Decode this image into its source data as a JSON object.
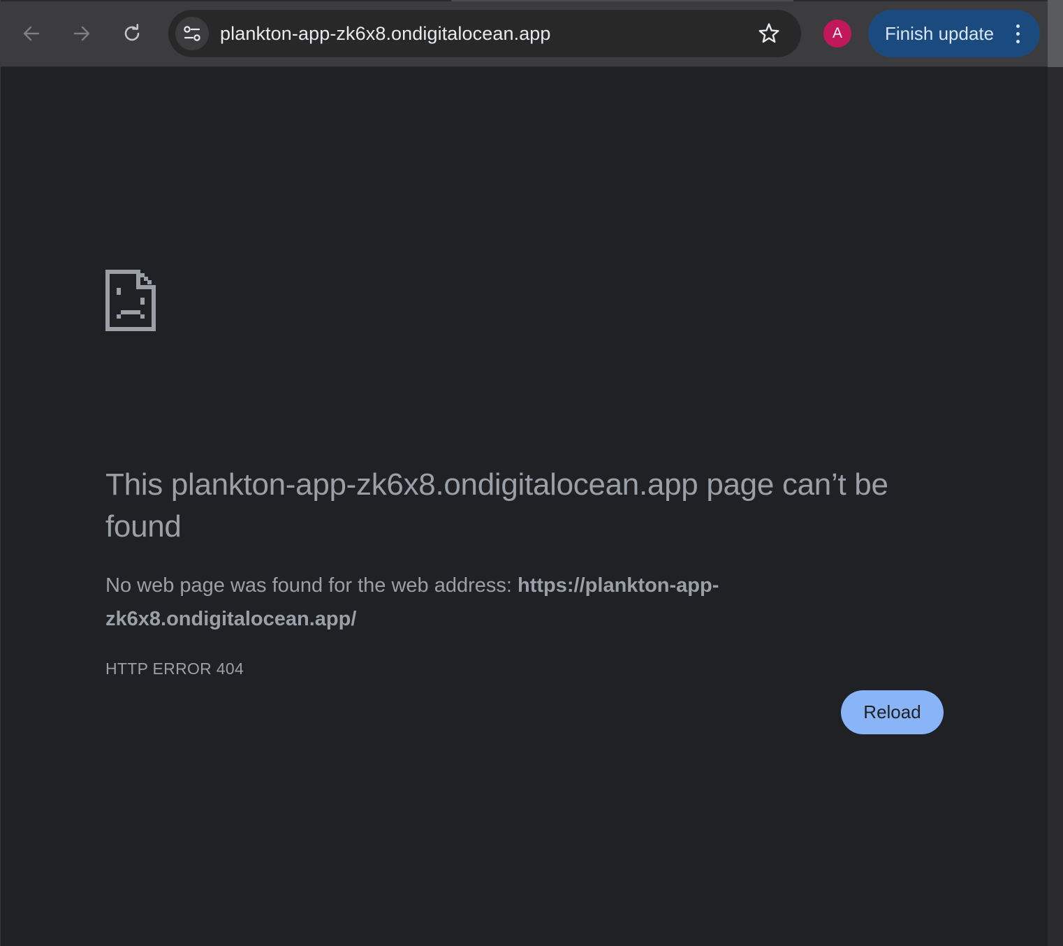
{
  "browser": {
    "url_display": "plankton-app-zk6x8.ondigitalocean.app",
    "profile_initial": "A",
    "update_button_label": "Finish update"
  },
  "error_page": {
    "title": "This plankton-app-zk6x8.ondigitalocean.app page can’t be found",
    "description_prefix": "No web page was found for the web address: ",
    "description_url": "https://plankton-app-zk6x8.ondigitalocean.app/",
    "error_code": "HTTP ERROR 404",
    "reload_label": "Reload"
  },
  "icons": {
    "back": "arrow-left-icon",
    "forward": "arrow-right-icon",
    "reload": "reload-icon",
    "site_info": "tune-icon",
    "bookmark": "star-icon",
    "menu": "kebab-icon",
    "error": "sad-file-icon"
  },
  "colors": {
    "page_background": "#202124",
    "toolbar_background": "#3c3c3e",
    "omnibox_background": "#282828",
    "text_secondary": "#9aa0a6",
    "reload_button": "#8ab4f8",
    "update_button": "#1b4a7e",
    "avatar": "#c2185b"
  }
}
